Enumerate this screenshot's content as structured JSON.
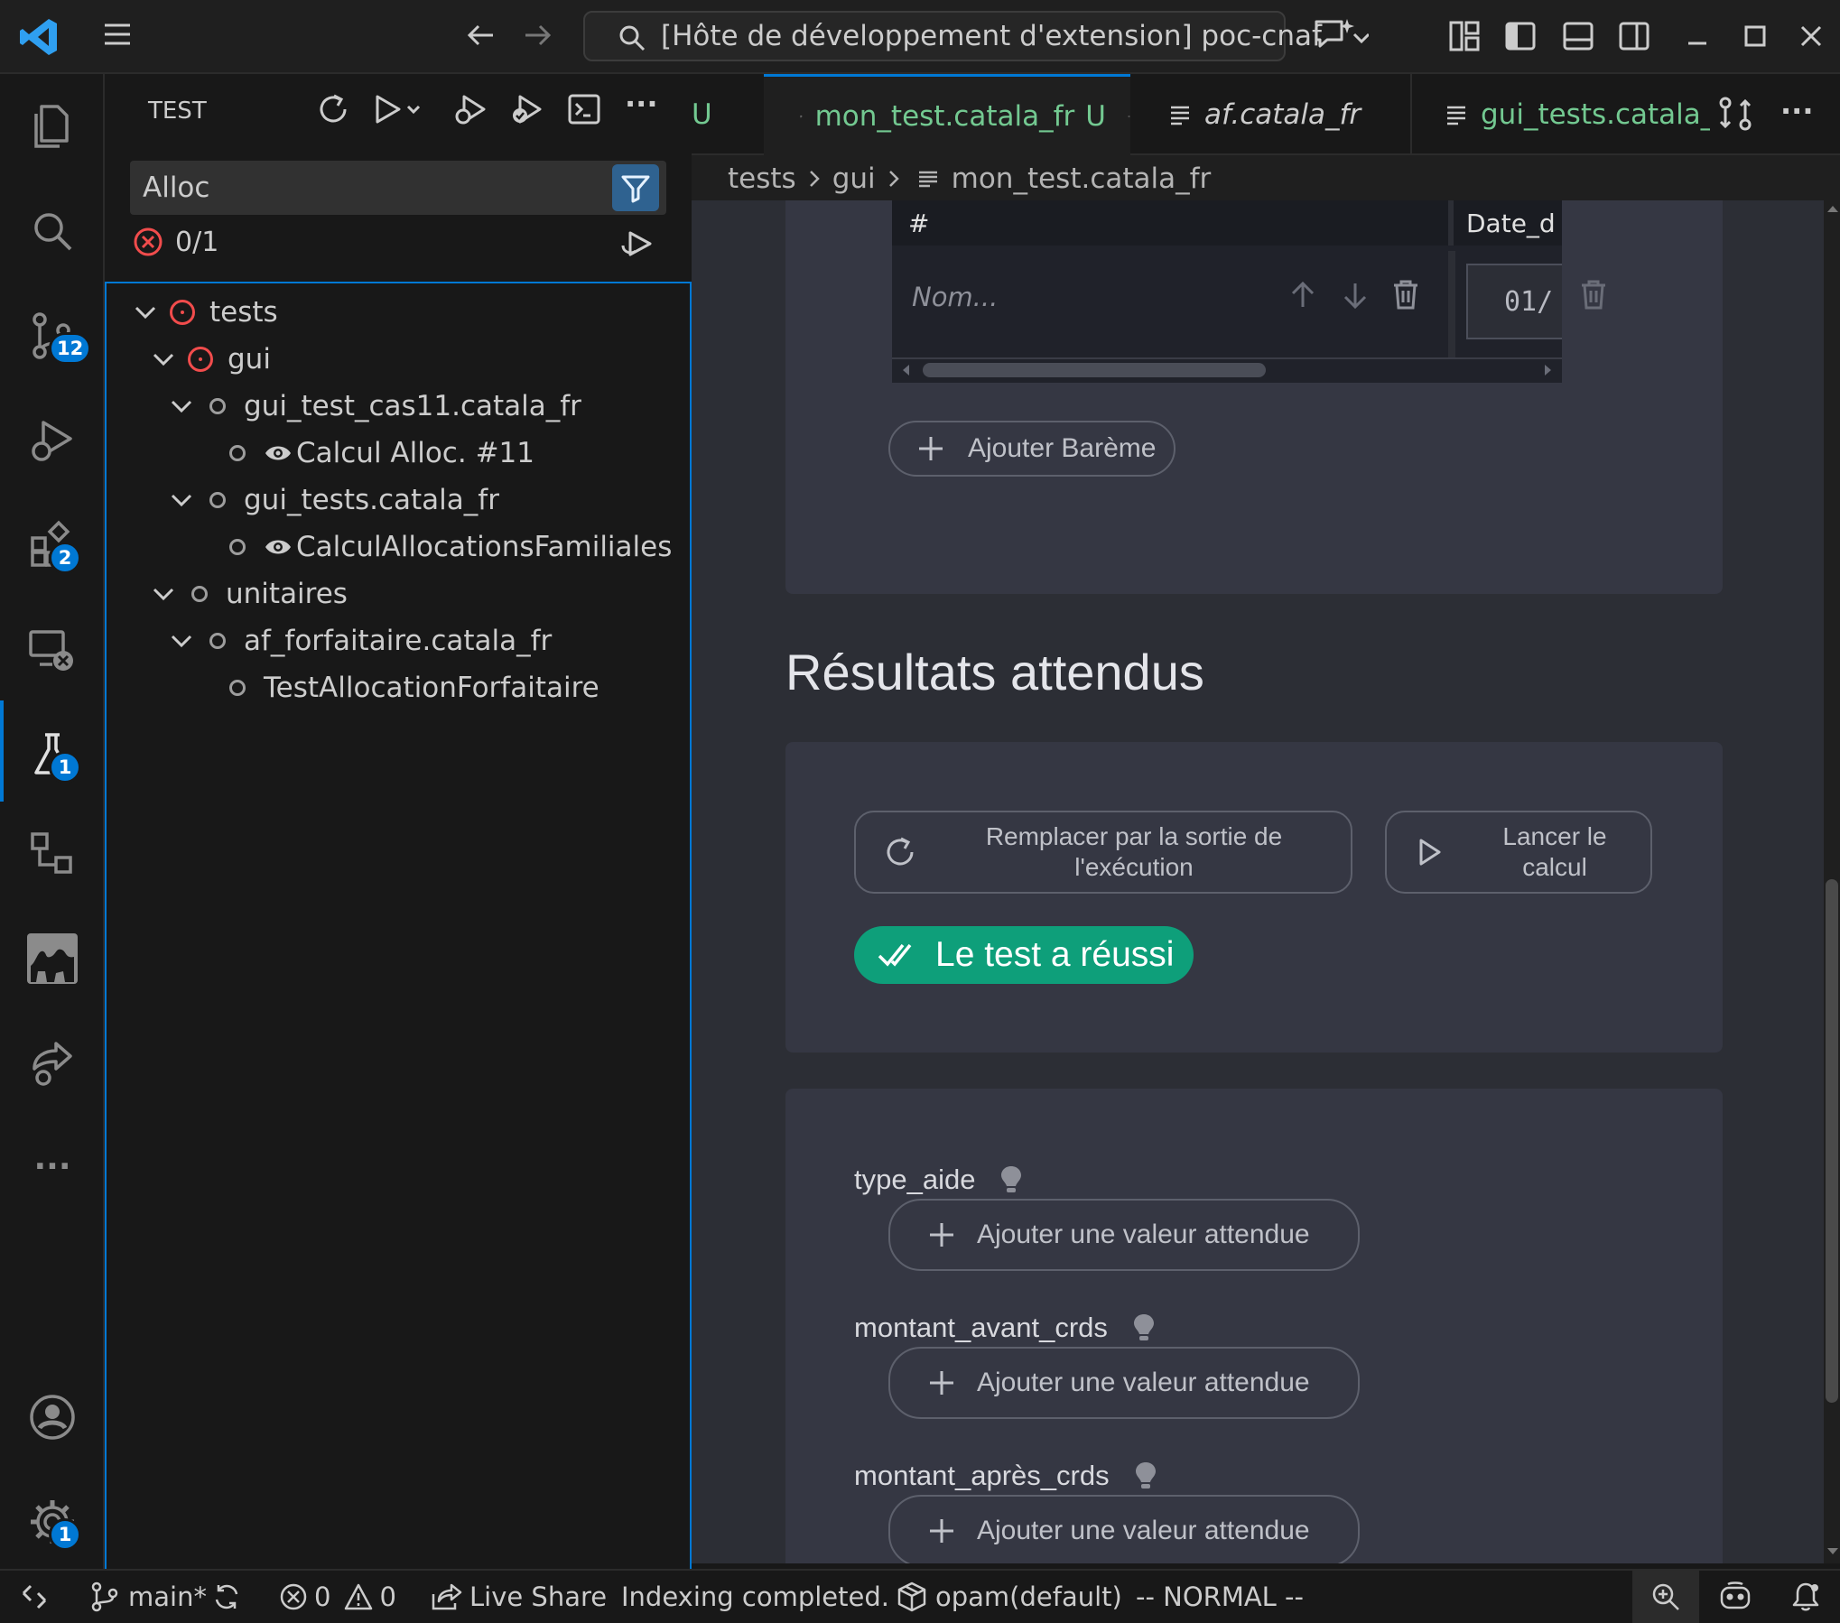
{
  "titlebar": {
    "search_text": "[Hôte de développement d'extension] poc-cnaf"
  },
  "activity": {
    "source_control_badge": "12",
    "extensions_badge": "2",
    "testing_badge": "1",
    "settings_badge": "1",
    "more_label": "···"
  },
  "sidebar": {
    "title": "TEST",
    "filter_value": "Alloc",
    "result_count": "0/1",
    "tree": [
      {
        "label": "tests",
        "status": "error"
      },
      {
        "label": "gui",
        "status": "error"
      },
      {
        "label": "gui_test_cas11.catala_fr",
        "status": "none"
      },
      {
        "label": "Calcul Alloc. #11",
        "status": "none"
      },
      {
        "label": "gui_tests.catala_fr",
        "status": "none"
      },
      {
        "label": "CalculAllocationsFamiliales",
        "status": "none"
      },
      {
        "label": "unitaires",
        "status": "none"
      },
      {
        "label": "af_forfaitaire.catala_fr",
        "status": "none"
      },
      {
        "label": "TestAllocationForfaitaire",
        "status": "none"
      }
    ]
  },
  "tabs": [
    {
      "label": "U",
      "state": "partial"
    },
    {
      "label": "mon_test.catala_fr",
      "modified": "U",
      "active": true
    },
    {
      "label": "af.catala_fr",
      "italic": true
    },
    {
      "label": "gui_tests.catala_fr"
    }
  ],
  "tab_more": "···",
  "breadcrumbs": [
    "tests",
    "gui",
    "mon_test.catala_fr"
  ],
  "editor": {
    "table": {
      "col_hash": "#",
      "col_date": "Date_d",
      "name_placeholder": "Nom...",
      "date_value": "01/"
    },
    "add_bareme": "Ajouter Barème",
    "section_title": "Résultats attendus",
    "replace_button": "Remplacer par la sortie de l'exécution",
    "run_button": "Lancer le calcul",
    "success_badge": "Le test a réussi",
    "success_color": "#0e9f7a",
    "fields": [
      {
        "name": "type_aide",
        "add_label": "Ajouter une valeur attendue"
      },
      {
        "name": "montant_avant_crds",
        "add_label": "Ajouter une valeur attendue"
      },
      {
        "name": "montant_après_crds",
        "add_label": "Ajouter une valeur attendue"
      }
    ]
  },
  "statusbar": {
    "branch": "main*",
    "errors": "0",
    "warnings": "0",
    "live_share": "Live Share",
    "indexing": "Indexing completed.",
    "opam": "opam(default)",
    "mode": "-- NORMAL --"
  }
}
